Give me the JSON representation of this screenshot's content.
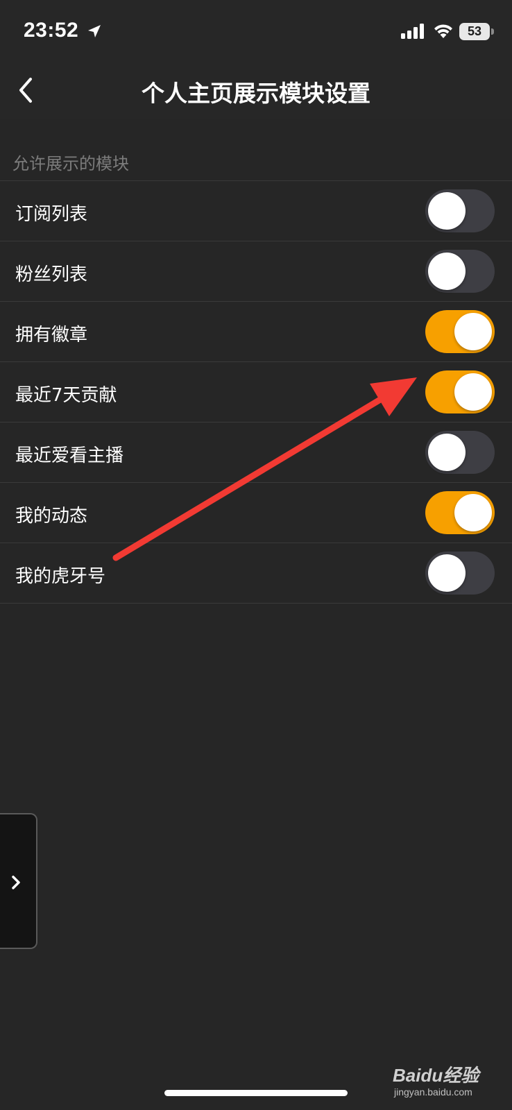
{
  "status_bar": {
    "time": "23:52",
    "battery": "53",
    "icons": [
      "location-arrow-icon",
      "signal-bars-icon",
      "wifi-icon",
      "battery-icon"
    ]
  },
  "nav": {
    "back_icon": "chevron-left-icon",
    "title": "个人主页展示模块设置"
  },
  "section": {
    "header": "允许展示的模块"
  },
  "items": [
    {
      "label": "订阅列表",
      "enabled": false
    },
    {
      "label": "粉丝列表",
      "enabled": false
    },
    {
      "label": "拥有徽章",
      "enabled": true
    },
    {
      "label": "最近7天贡献",
      "enabled": true
    },
    {
      "label": "最近爱看主播",
      "enabled": false
    },
    {
      "label": "我的动态",
      "enabled": true
    },
    {
      "label": "我的虎牙号",
      "enabled": false
    }
  ],
  "side_tab": {
    "icon": "chevron-right-icon"
  },
  "annotation": {
    "icon": "red-arrow-icon"
  },
  "watermark": {
    "text": "Baidu经验",
    "sub": "jingyan.baidu.com"
  },
  "colors": {
    "toggle_on": "#f7a000",
    "toggle_off": "#3e3e44",
    "background": "#262626",
    "annotation_arrow": "#f23a33"
  }
}
